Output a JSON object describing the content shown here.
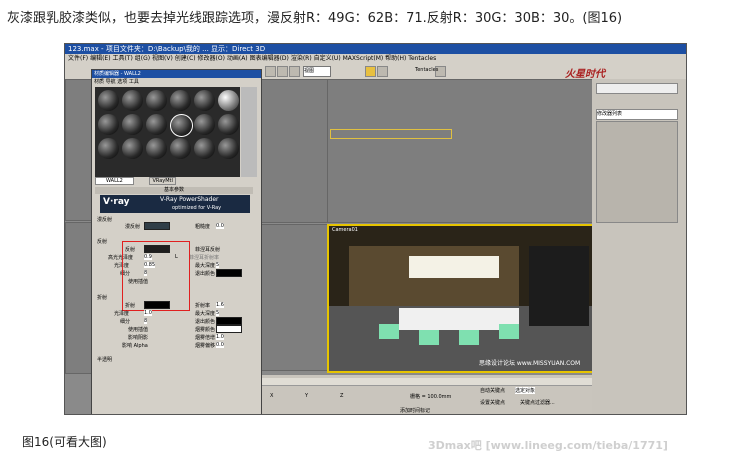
{
  "heading": "灰漆跟乳胶漆类似，也要去掉光线跟踪选项，漫反射R：49G：62B：71.反射R：30G：30B：30。(图16)",
  "caption": "图16(可看大图)",
  "footer": "3Dmax吧 [www.lineeg.com/tieba/1771]",
  "app": {
    "title": "123.max - 项目文件夹：D:\\Backup\\我的 ... 显示：Direct 3D",
    "menus": [
      "文件(F)",
      "编辑(E)",
      "工具(T)",
      "组(G)",
      "视图(V)",
      "创建(C)",
      "修改器(O)",
      "动画(A)",
      "图表编辑器(D)",
      "渲染(R)",
      "自定义(U)",
      "MAXScript(M)",
      "帮助(H)",
      "Tentacles"
    ],
    "view_select": "视图",
    "viewports": {
      "camera": "Camera01"
    },
    "right_panel": {
      "label": "修改器列表"
    }
  },
  "material_editor": {
    "title": "材质编辑器 - WALL2",
    "menus": [
      "材质",
      "导航",
      "选项",
      "工具"
    ],
    "material_name": "WALL2",
    "material_type": "VRayMtl",
    "rollout_basic": "基本参数",
    "vray_banner": {
      "title": "V-Ray PowerShader",
      "subtitle": "optimized for V-Ray"
    },
    "diffuse": {
      "section": "漫反射",
      "label": "漫反射",
      "roughness_label": "粗糙度",
      "roughness_value": "0.0"
    },
    "reflection": {
      "section": "反射",
      "reflect_label": "反射",
      "hilight_gloss_label": "高光光泽度",
      "hilight_gloss_value": "0.9",
      "refl_gloss_label": "光泽度",
      "refl_gloss_value": "0.85",
      "subdivs_label": "细分",
      "subdivs_value": "8",
      "use_interp_label": "使用插值",
      "fresnel_label": "菲涅耳反射",
      "fresnel_ior_label": "菲涅耳折射率",
      "max_depth_label": "最大深度",
      "max_depth_value": "5",
      "exit_color_label": "退出颜色",
      "L": "L"
    },
    "refraction": {
      "section": "折射",
      "refract_label": "折射",
      "ior_label": "折射率",
      "ior_value": "1.6",
      "gloss_label": "光泽度",
      "gloss_value": "1.0",
      "max_depth_label": "最大深度",
      "max_depth_value": "5",
      "subdivs_label": "细分",
      "subdivs_value": "8",
      "exit_color_label": "退出颜色",
      "use_interp_label": "使用插值",
      "affect_shadows_label": "影响阴影",
      "fog_color_label": "烟雾颜色",
      "fog_mult_label": "烟雾倍增",
      "fog_bias_label": "烟雾偏移",
      "affect_alpha_label": "影响 Alpha",
      "fog_mult_value": "1.0",
      "fog_bias_value": "0.0"
    },
    "translucency": "半透明"
  },
  "status": {
    "grid": "栅格 = 100.0mm",
    "auto_key": "自动关键点",
    "selected": "选定对象",
    "set_key": "设置关键点",
    "key_filters": "关键点过滤器...",
    "add_time_tag": "添加时间标记",
    "x_label": "X",
    "y_label": "Y",
    "z_label": "Z"
  },
  "watermark_top": "火星时代",
  "watermark_bottom": "思缘设计论坛 www.MISSYUAN.COM"
}
